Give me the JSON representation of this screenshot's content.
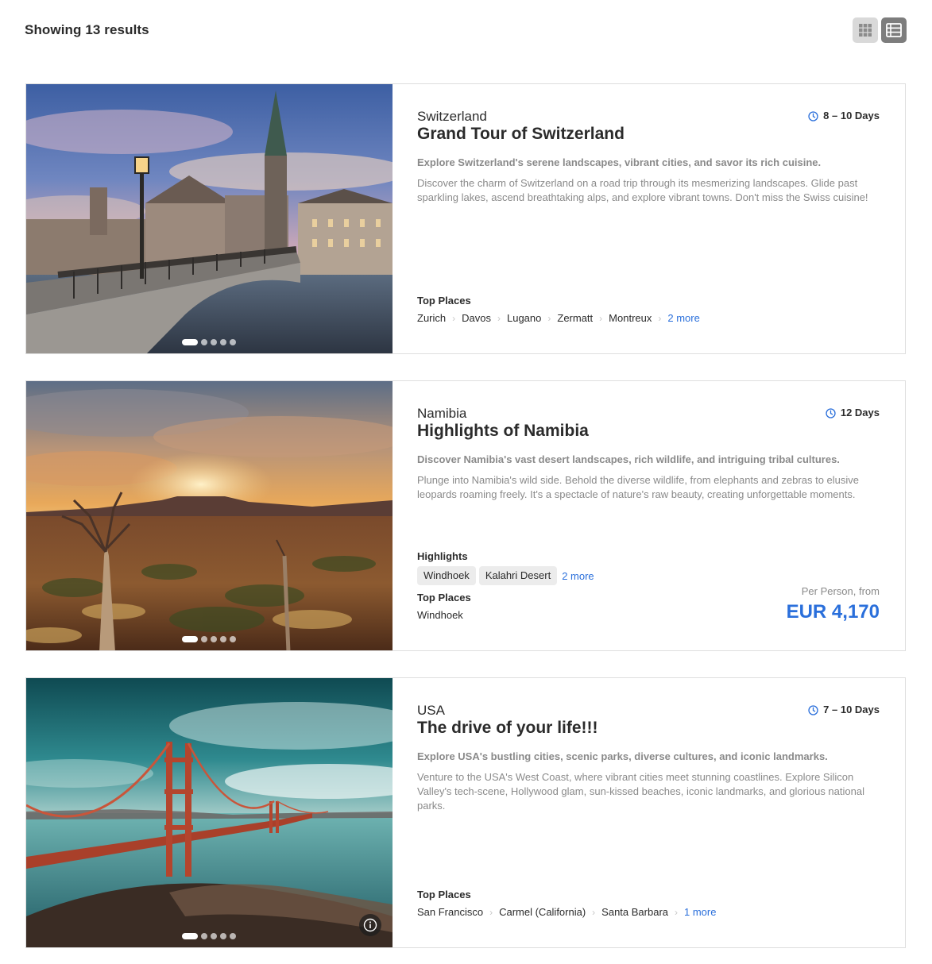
{
  "header": {
    "results_text": "Showing 13 results",
    "grid_view_icon": "grid-icon",
    "list_view_icon": "list-icon",
    "active_view": "list"
  },
  "colors": {
    "accent": "#2a6fdb",
    "muted_text": "#8a8a8a",
    "chip_bg": "#ececec"
  },
  "tours": [
    {
      "country": "Switzerland",
      "title": "Grand Tour of Switzerland",
      "duration": "8 – 10 Days",
      "tagline": "Explore Switzerland's serene landscapes, vibrant cities, and savor its rich cuisine.",
      "description": "Discover the charm of Switzerland on a road trip through its mesmerizing landscapes. Glide past sparkling lakes, ascend breathtaking alps, and explore vibrant towns. Don't miss the Swiss cuisine!",
      "top_places_label": "Top Places",
      "top_places": [
        "Zurich",
        "Davos",
        "Lugano",
        "Zermatt",
        "Montreux"
      ],
      "more_places": "2 more",
      "image_subject": "Zurich bridge and church spire at sunset",
      "slides": 5
    },
    {
      "country": "Namibia",
      "title": "Highlights of Namibia",
      "duration": "12 Days",
      "tagline": "Discover Namibia's vast desert landscapes, rich wildlife, and intriguing tribal cultures.",
      "description": "Plunge into Namibia's wild side. Behold the diverse wildlife, from elephants and zebras to elusive leopards roaming freely. It's a spectacle of nature's raw beauty, creating unforgettable moments.",
      "highlights_label": "Highlights",
      "highlights": [
        "Windhoek",
        "Kalahri Desert"
      ],
      "more_highlights": "2 more",
      "top_places_label": "Top Places",
      "top_places": [
        "Windhoek"
      ],
      "price_label": "Per Person, from",
      "price": "EUR 4,170",
      "image_subject": "Namibian desert landscape with quiver tree at sunset",
      "slides": 5
    },
    {
      "country": "USA",
      "title": "The drive of your life!!!",
      "duration": "7 – 10 Days",
      "tagline": "Explore USA's bustling cities, scenic parks, diverse cultures, and iconic landmarks.",
      "description": "Venture to the USA's West Coast, where vibrant cities meet stunning coastlines. Explore Silicon Valley's tech-scene, Hollywood glam, sun-kissed beaches, iconic landmarks, and glorious national parks.",
      "top_places_label": "Top Places",
      "top_places": [
        "San Francisco",
        "Carmel (California)",
        "Santa Barbara"
      ],
      "more_places": "1 more",
      "image_subject": "Golden Gate Bridge over the bay",
      "slides": 5,
      "info_icon": "info-icon"
    }
  ]
}
